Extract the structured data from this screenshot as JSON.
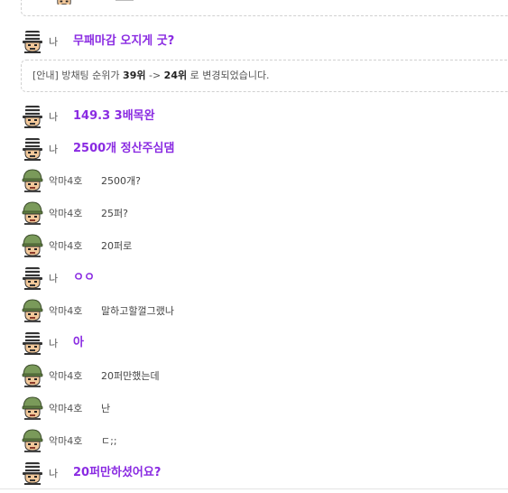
{
  "notice": {
    "prefix": "[안내] 방채팅 순위가 ",
    "from": "39위",
    "arrow": " -> ",
    "to": "24위",
    "suffix": " 로 변경되었습니다."
  },
  "messages": [
    {
      "sender": "me",
      "name": "나",
      "text": "무패마감 오지게 굿?"
    },
    {
      "sender": "me",
      "name": "나",
      "text": "149.3 3배목완"
    },
    {
      "sender": "me",
      "name": "나",
      "text": "2500개 정산주심댐"
    },
    {
      "sender": "other",
      "name": "악마4호",
      "text": "2500개?"
    },
    {
      "sender": "other",
      "name": "악마4호",
      "text": "25퍼?"
    },
    {
      "sender": "other",
      "name": "악마4호",
      "text": "20퍼로"
    },
    {
      "sender": "me",
      "name": "나",
      "text": "ㅇㅇ"
    },
    {
      "sender": "other",
      "name": "악마4호",
      "text": "말하고할껄그랬나"
    },
    {
      "sender": "me",
      "name": "나",
      "text": "아"
    },
    {
      "sender": "other",
      "name": "악마4호",
      "text": "20퍼만했는데"
    },
    {
      "sender": "other",
      "name": "악마4호",
      "text": "난"
    },
    {
      "sender": "other",
      "name": "악마4호",
      "text": "ㄷ;;"
    },
    {
      "sender": "me",
      "name": "나",
      "text": "20퍼만하셨어요?"
    }
  ],
  "avatars": {
    "me": "striped-beanie-avatar-icon",
    "other": "green-helmet-avatar-icon"
  }
}
